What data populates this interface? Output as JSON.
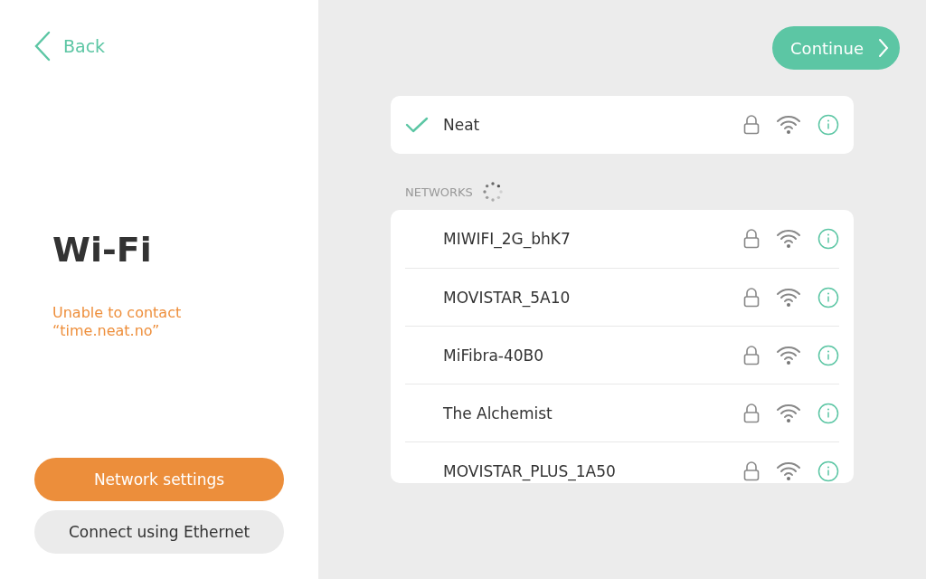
{
  "back": {
    "label": "Back"
  },
  "title": "Wi-Fi",
  "error": "Unable to contact\n“time.neat.no”",
  "buttons": [
    {
      "label": "Network settings",
      "kind": "primary"
    },
    {
      "label": "Connect using Ethernet",
      "kind": "secondary"
    }
  ],
  "continue": {
    "label": "Continue"
  },
  "current": {
    "name": "Neat",
    "connected": true,
    "locked": true
  },
  "networks_heading": "NETWORKS",
  "networks": [
    {
      "name": "MIWIFI_2G_bhK7",
      "connected": false,
      "locked": true
    },
    {
      "name": "MOVISTAR_5A10",
      "connected": false,
      "locked": true
    },
    {
      "name": "MiFibra-40B0",
      "connected": false,
      "locked": true
    },
    {
      "name": "The Alchemist",
      "connected": false,
      "locked": true
    },
    {
      "name": "MOVISTAR_PLUS_1A50",
      "connected": false,
      "locked": true
    }
  ]
}
